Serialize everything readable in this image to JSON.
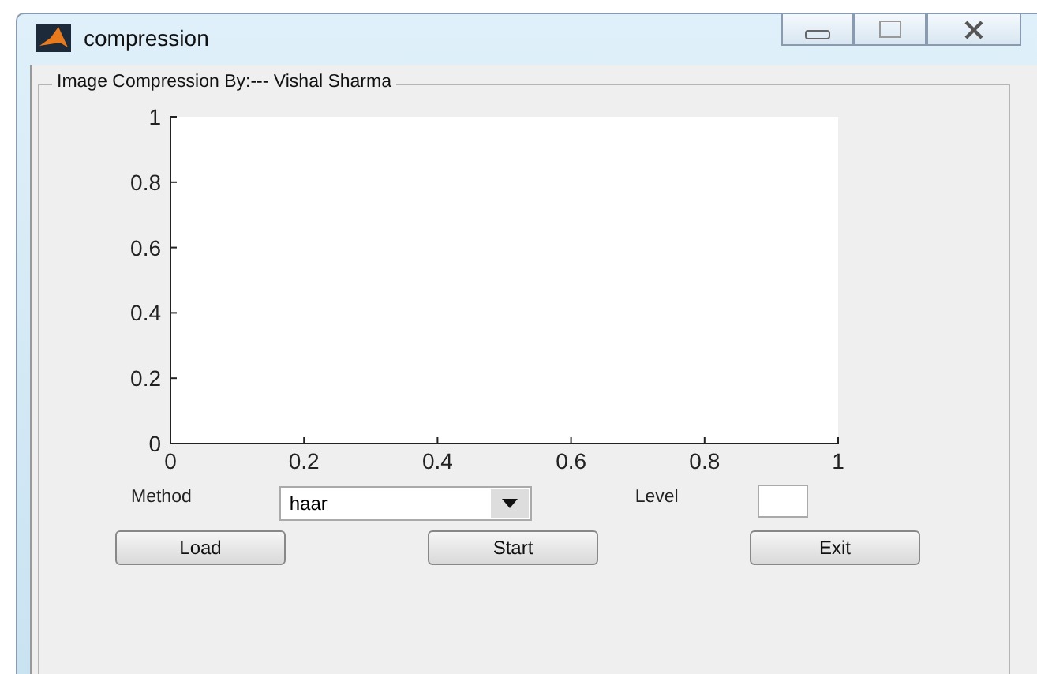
{
  "window": {
    "title": "compression"
  },
  "panel": {
    "title": "Image Compression By:--- Vishal Sharma"
  },
  "plot": {
    "chart_data": {
      "type": "line",
      "xlim": [
        0,
        1
      ],
      "ylim": [
        0,
        1
      ],
      "xticks": [
        0,
        0.2,
        0.4,
        0.6,
        0.8,
        1
      ],
      "yticks": [
        0,
        0.2,
        0.4,
        0.6,
        0.8,
        1
      ]
    }
  },
  "method": {
    "label": "Method",
    "value": "haar"
  },
  "level": {
    "label": "Level"
  },
  "buttons": [
    "Load",
    "Start",
    "Exit"
  ]
}
